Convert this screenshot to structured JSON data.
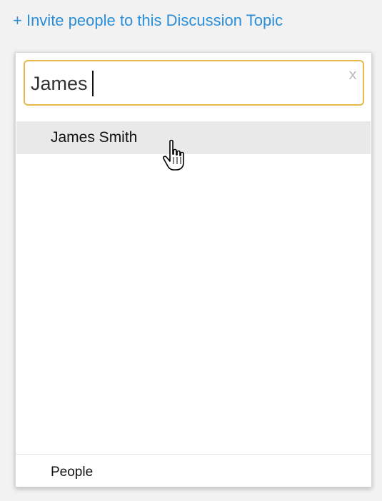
{
  "invite": {
    "link_text": "+ Invite people to this Discussion Topic",
    "accent_color": "#2b8ed8"
  },
  "search": {
    "value": "James",
    "clear_label": "x",
    "focus_border_color": "#e8b84a"
  },
  "results": [
    {
      "label": "James Smith"
    }
  ],
  "footer": {
    "category_label": "People"
  },
  "icons": {
    "cursor": "hand-pointer-icon",
    "clear": "close-icon"
  }
}
